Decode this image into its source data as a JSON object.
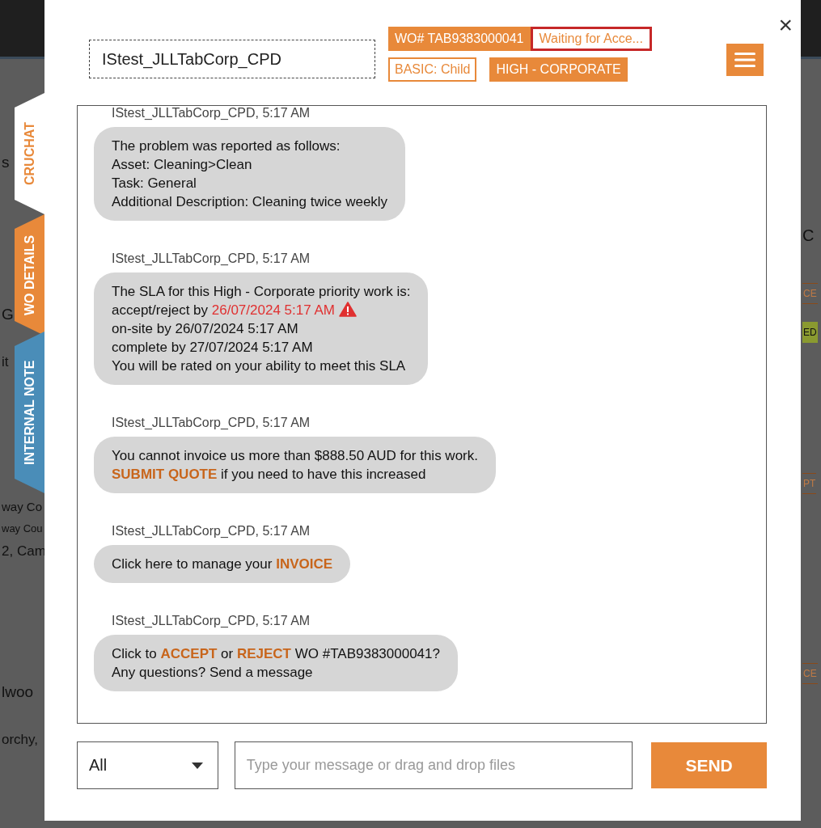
{
  "background": {
    "left": [
      {
        "text": "s",
        "kind": "title"
      },
      {
        "text": "G",
        "kind": "title"
      },
      {
        "text": "it",
        "kind": "small"
      },
      {
        "text": "way Co",
        "kind": "mid"
      },
      {
        "text": "way Cou",
        "kind": "tiny"
      },
      {
        "text": "2, Cam",
        "kind": "small"
      },
      {
        "text": "lwoo",
        "kind": "title"
      },
      {
        "text": "orchy, ",
        "kind": "small"
      }
    ],
    "right": [
      {
        "text": "C",
        "kind": "plain"
      },
      {
        "text": "CE",
        "kind": "outline"
      },
      {
        "text": "ED",
        "kind": "green"
      },
      {
        "text": "PT",
        "kind": "outline"
      },
      {
        "text": "CE",
        "kind": "outline"
      }
    ]
  },
  "side_tabs": [
    {
      "label": "CRUCHAT",
      "selected": true,
      "color": "#e8893a"
    },
    {
      "label": "WO DETAILS",
      "selected": false,
      "color": "#e8893a"
    },
    {
      "label": "INTERNAL NOTE",
      "selected": false,
      "color": "#4a8db8"
    }
  ],
  "header": {
    "requester": "IStest_JLLTabCorp_CPD",
    "badges": [
      {
        "text": "WO# TAB9383000041",
        "kind": "filled"
      },
      {
        "text": "Waiting for Acce...",
        "kind": "status"
      }
    ],
    "tags": [
      {
        "text": "BASIC: Child",
        "kind": "outline"
      },
      {
        "text": "HIGH - CORPORATE",
        "kind": "filled"
      }
    ],
    "close": "×"
  },
  "messages": [
    {
      "sender": "IStest_JLLTabCorp_CPD, 5:17 AM",
      "lines": [
        [
          {
            "text": "The problem was reported as follows:",
            "kind": "plain"
          }
        ],
        [
          {
            "text": "Asset: Cleaning>Clean",
            "kind": "plain"
          }
        ],
        [
          {
            "text": "Task: General",
            "kind": "plain"
          }
        ],
        [
          {
            "text": "Additional Description: Cleaning twice weekly",
            "kind": "plain"
          }
        ]
      ]
    },
    {
      "sender": "IStest_JLLTabCorp_CPD, 5:17 AM",
      "lines": [
        [
          {
            "text": "The SLA for this High - Corporate priority work is:",
            "kind": "plain"
          }
        ],
        [
          {
            "text": "accept/reject by ",
            "kind": "plain"
          },
          {
            "text": "26/07/2024 5:17 AM",
            "kind": "alert"
          }
        ],
        [
          {
            "text": "on-site by 26/07/2024 5:17 AM",
            "kind": "plain"
          }
        ],
        [
          {
            "text": "complete by 27/07/2024 5:17 AM",
            "kind": "plain"
          }
        ],
        [
          {
            "text": "You will be rated on your ability to meet this SLA",
            "kind": "plain"
          }
        ]
      ]
    },
    {
      "sender": "IStest_JLLTabCorp_CPD, 5:17 AM",
      "lines": [
        [
          {
            "text": "You cannot invoice us more than $888.50 AUD for this work.",
            "kind": "plain"
          }
        ],
        [
          {
            "text": "SUBMIT QUOTE",
            "kind": "link"
          },
          {
            "text": " if you need to have this increased",
            "kind": "plain"
          }
        ]
      ]
    },
    {
      "sender": "IStest_JLLTabCorp_CPD, 5:17 AM",
      "lines": [
        [
          {
            "text": "Click here to manage your ",
            "kind": "plain"
          },
          {
            "text": "INVOICE",
            "kind": "link"
          }
        ]
      ]
    },
    {
      "sender": "IStest_JLLTabCorp_CPD, 5:17 AM",
      "lines": [
        [
          {
            "text": "Click to ",
            "kind": "plain"
          },
          {
            "text": "ACCEPT",
            "kind": "link"
          },
          {
            "text": " or ",
            "kind": "plain"
          },
          {
            "text": "REJECT",
            "kind": "link"
          },
          {
            "text": " WO #TAB9383000041?",
            "kind": "plain"
          }
        ],
        [
          {
            "text": "Any questions? Send a message",
            "kind": "plain"
          }
        ]
      ]
    }
  ],
  "composer": {
    "filter": "All",
    "placeholder": "Type your message or drag and drop files",
    "send": "SEND"
  }
}
